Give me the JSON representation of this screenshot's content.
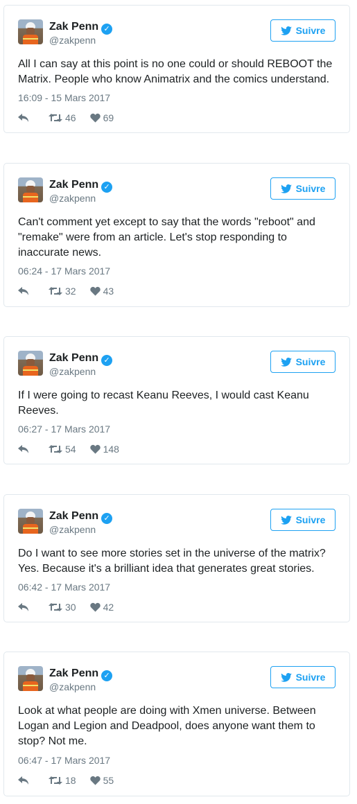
{
  "follow_label": "Suivre",
  "colors": {
    "accent": "#1da1f2",
    "muted": "#697882",
    "text": "#1c2022",
    "border": "#e1e8ed"
  },
  "tweets": [
    {
      "name": "Zak Penn",
      "handle": "@zakpenn",
      "text": "All I can say at this point is no one could or should REBOOT the Matrix. People who know Animatrix and the comics understand.",
      "date": "16:09 - 15 Mars 2017",
      "retweets": "46",
      "likes": "69"
    },
    {
      "name": "Zak Penn",
      "handle": "@zakpenn",
      "text": "Can't comment yet except to say that the words \"reboot\" and \"remake\" were from an article. Let's stop responding to inaccurate news.",
      "date": "06:24 - 17 Mars 2017",
      "retweets": "32",
      "likes": "43"
    },
    {
      "name": "Zak Penn",
      "handle": "@zakpenn",
      "text": "If I were going to recast Keanu Reeves, I would cast Keanu Reeves.",
      "date": "06:27 - 17 Mars 2017",
      "retweets": "54",
      "likes": "148"
    },
    {
      "name": "Zak Penn",
      "handle": "@zakpenn",
      "text": "Do I want to see more stories set in the universe of the matrix? Yes. Because it's a brilliant idea that generates great stories.",
      "date": "06:42 - 17 Mars 2017",
      "retweets": "30",
      "likes": "42"
    },
    {
      "name": "Zak Penn",
      "handle": "@zakpenn",
      "text": "Look at what people are doing with Xmen universe. Between Logan and Legion and Deadpool, does anyone want them to stop? Not me.",
      "date": "06:47 - 17 Mars 2017",
      "retweets": "18",
      "likes": "55"
    }
  ]
}
